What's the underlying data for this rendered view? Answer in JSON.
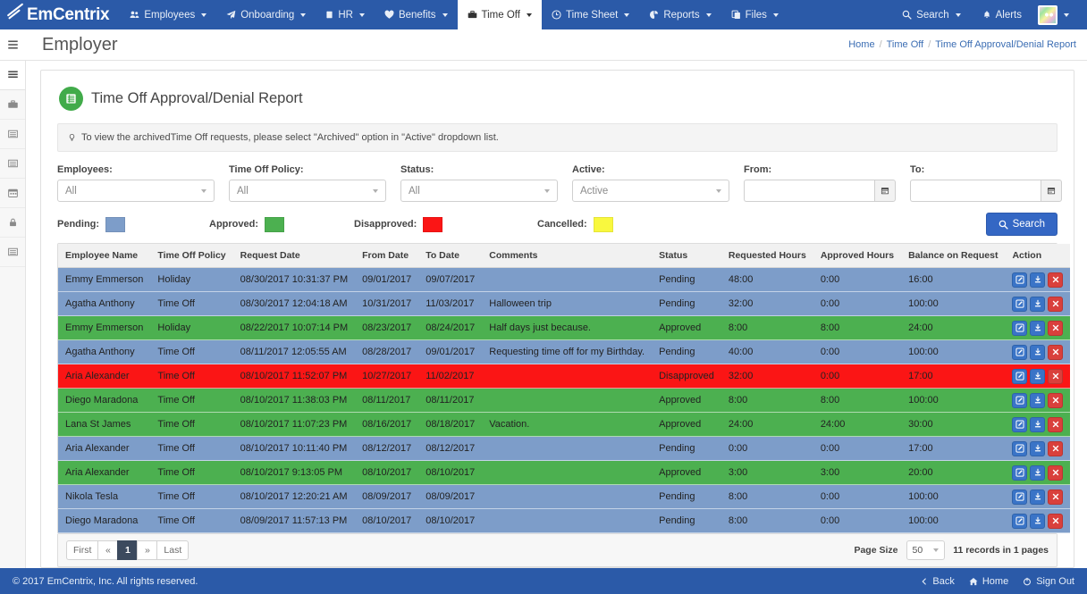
{
  "nav": {
    "brand": "EmCentrix",
    "items": [
      {
        "label": "Employees",
        "icon": "users-icon",
        "caret": true,
        "active": false
      },
      {
        "label": "Onboarding",
        "icon": "paper-plane-icon",
        "caret": true,
        "active": false
      },
      {
        "label": "HR",
        "icon": "book-icon",
        "caret": true,
        "active": false
      },
      {
        "label": "Benefits",
        "icon": "heart-icon",
        "caret": true,
        "active": false
      },
      {
        "label": "Time Off",
        "icon": "suitcase-icon",
        "caret": true,
        "active": true
      },
      {
        "label": "Time Sheet",
        "icon": "clock-icon",
        "caret": true,
        "active": false
      },
      {
        "label": "Reports",
        "icon": "pie-chart-icon",
        "caret": true,
        "active": false
      },
      {
        "label": "Files",
        "icon": "files-icon",
        "caret": true,
        "active": false
      }
    ],
    "right": {
      "search_label": "Search",
      "alerts_label": "Alerts"
    }
  },
  "subheader": {
    "title": "Employer",
    "breadcrumb": [
      "Home",
      "Time Off",
      "Time Off Approval/Denial Report"
    ]
  },
  "sidebar": {
    "items": [
      {
        "name": "menu-toggle",
        "icon": "hamburger-icon"
      },
      {
        "name": "briefcase",
        "icon": "briefcase-icon"
      },
      {
        "name": "list-1",
        "icon": "list-icon"
      },
      {
        "name": "list-2",
        "icon": "list-icon"
      },
      {
        "name": "calendar",
        "icon": "calendar-icon"
      },
      {
        "name": "lock",
        "icon": "lock-icon"
      },
      {
        "name": "list-3",
        "icon": "list-icon"
      }
    ]
  },
  "report": {
    "title": "Time Off Approval/Denial Report",
    "info_text": "To view the archivedTime Off requests, please select \"Archived\" option in \"Active\" dropdown list."
  },
  "filters": [
    {
      "label": "Employees:",
      "value": "All",
      "type": "select",
      "name": "employees-filter"
    },
    {
      "label": "Time Off Policy:",
      "value": "All",
      "type": "select",
      "name": "time-off-policy-filter"
    },
    {
      "label": "Status:",
      "value": "All",
      "type": "select",
      "name": "status-filter"
    },
    {
      "label": "Active:",
      "value": "Active",
      "type": "select",
      "name": "active-filter"
    },
    {
      "label": "From:",
      "value": "",
      "type": "date",
      "name": "from-date-filter"
    },
    {
      "label": "To:",
      "value": "",
      "type": "date",
      "name": "to-date-filter"
    }
  ],
  "legend": [
    {
      "label": "Pending:",
      "color": "#7d9dc9"
    },
    {
      "label": "Approved:",
      "color": "#4cb050"
    },
    {
      "label": "Disapproved:",
      "color": "#fb1515"
    },
    {
      "label": "Cancelled:",
      "color": "#f9f83e"
    }
  ],
  "search_button": "Search",
  "table": {
    "columns": [
      "Employee Name",
      "Time Off Policy",
      "Request Date",
      "From Date",
      "To Date",
      "Comments",
      "Status",
      "Requested Hours",
      "Approved Hours",
      "Balance on Request",
      "Action"
    ],
    "rows": [
      {
        "employee": "Emmy Emmerson",
        "policy": "Holiday",
        "request_date": "08/30/2017 10:31:37 PM",
        "from": "09/01/2017",
        "to": "09/07/2017",
        "comments": "",
        "status": "Pending",
        "requested": "48:00",
        "approved": "0:00",
        "balance": "16:00",
        "state": "pending"
      },
      {
        "employee": "Agatha Anthony",
        "policy": "Time Off",
        "request_date": "08/30/2017 12:04:18 AM",
        "from": "10/31/2017",
        "to": "11/03/2017",
        "comments": "Halloween trip",
        "status": "Pending",
        "requested": "32:00",
        "approved": "0:00",
        "balance": "100:00",
        "state": "pending"
      },
      {
        "employee": "Emmy Emmerson",
        "policy": "Holiday",
        "request_date": "08/22/2017 10:07:14 PM",
        "from": "08/23/2017",
        "to": "08/24/2017",
        "comments": "Half days just because.",
        "status": "Approved",
        "requested": "8:00",
        "approved": "8:00",
        "balance": "24:00",
        "state": "approved"
      },
      {
        "employee": "Agatha Anthony",
        "policy": "Time Off",
        "request_date": "08/11/2017 12:05:55 AM",
        "from": "08/28/2017",
        "to": "09/01/2017",
        "comments": "Requesting time off for my Birthday.",
        "status": "Pending",
        "requested": "40:00",
        "approved": "0:00",
        "balance": "100:00",
        "state": "pending"
      },
      {
        "employee": "Aria Alexander",
        "policy": "Time Off",
        "request_date": "08/10/2017 11:52:07 PM",
        "from": "10/27/2017",
        "to": "11/02/2017",
        "comments": "",
        "status": "Disapproved",
        "requested": "32:00",
        "approved": "0:00",
        "balance": "17:00",
        "state": "disapproved"
      },
      {
        "employee": "Diego Maradona",
        "policy": "Time Off",
        "request_date": "08/10/2017 11:38:03 PM",
        "from": "08/11/2017",
        "to": "08/11/2017",
        "comments": "",
        "status": "Approved",
        "requested": "8:00",
        "approved": "8:00",
        "balance": "100:00",
        "state": "approved"
      },
      {
        "employee": "Lana St James",
        "policy": "Time Off",
        "request_date": "08/10/2017 11:07:23 PM",
        "from": "08/16/2017",
        "to": "08/18/2017",
        "comments": "Vacation.",
        "status": "Approved",
        "requested": "24:00",
        "approved": "24:00",
        "balance": "30:00",
        "state": "approved"
      },
      {
        "employee": "Aria Alexander",
        "policy": "Time Off",
        "request_date": "08/10/2017 10:11:40 PM",
        "from": "08/12/2017",
        "to": "08/12/2017",
        "comments": "",
        "status": "Pending",
        "requested": "0:00",
        "approved": "0:00",
        "balance": "17:00",
        "state": "pending"
      },
      {
        "employee": "Aria Alexander",
        "policy": "Time Off",
        "request_date": "08/10/2017 9:13:05 PM",
        "from": "08/10/2017",
        "to": "08/10/2017",
        "comments": "",
        "status": "Approved",
        "requested": "3:00",
        "approved": "3:00",
        "balance": "20:00",
        "state": "approved"
      },
      {
        "employee": "Nikola Tesla",
        "policy": "Time Off",
        "request_date": "08/10/2017 12:20:21 AM",
        "from": "08/09/2017",
        "to": "08/09/2017",
        "comments": "",
        "status": "Pending",
        "requested": "8:00",
        "approved": "0:00",
        "balance": "100:00",
        "state": "pending"
      },
      {
        "employee": "Diego Maradona",
        "policy": "Time Off",
        "request_date": "08/09/2017 11:57:13 PM",
        "from": "08/10/2017",
        "to": "08/10/2017",
        "comments": "",
        "status": "Pending",
        "requested": "8:00",
        "approved": "0:00",
        "balance": "100:00",
        "state": "pending"
      }
    ]
  },
  "pager": {
    "first": "First",
    "prev": "«",
    "page": "1",
    "next": "»",
    "last": "Last",
    "page_size_label": "Page Size",
    "page_size_value": "50",
    "records_text": "11 records in 1 pages"
  },
  "footer": {
    "copyright": "© 2017 EmCentrix, Inc. All rights reserved.",
    "links": [
      {
        "label": "Back",
        "icon": "chevron-left-icon"
      },
      {
        "label": "Home",
        "icon": "home-icon"
      },
      {
        "label": "Sign Out",
        "icon": "power-icon"
      }
    ]
  }
}
